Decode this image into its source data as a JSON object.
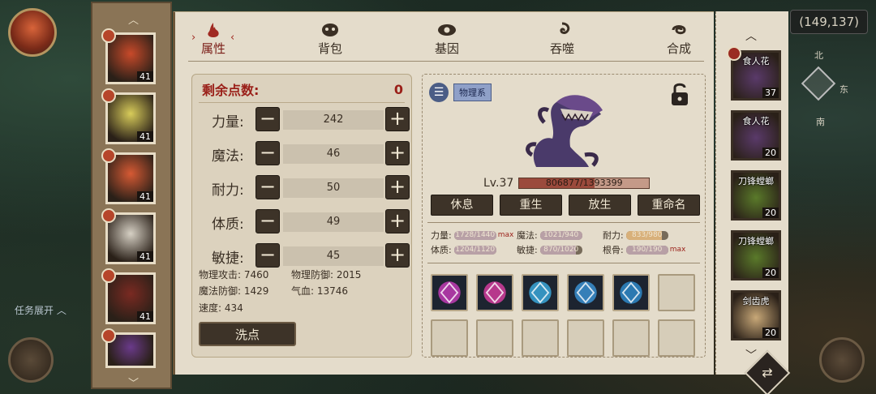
{
  "map": {
    "coords": "(149,137)",
    "compass": {
      "north": "北",
      "east": "东",
      "south": "南"
    },
    "quest_toggle": "任务展开"
  },
  "tabs": [
    {
      "label": "属性",
      "active": true,
      "icon": "flame-icon"
    },
    {
      "label": "背包",
      "active": false,
      "icon": "beast-head-icon"
    },
    {
      "label": "基因",
      "active": false,
      "icon": "eye-emblem-icon"
    },
    {
      "label": "吞噬",
      "active": false,
      "icon": "swirl-icon"
    },
    {
      "label": "合成",
      "active": false,
      "icon": "spiral-icon"
    }
  ],
  "stats": {
    "remaining_label": "剩余点数:",
    "remaining_value": "0",
    "attributes": [
      {
        "label": "力量:",
        "value": "242"
      },
      {
        "label": "魔法:",
        "value": "46"
      },
      {
        "label": "耐力:",
        "value": "50"
      },
      {
        "label": "体质:",
        "value": "49"
      },
      {
        "label": "敏捷:",
        "value": "45"
      }
    ],
    "minus": "−",
    "plus": "+",
    "derived": [
      {
        "text": "物理攻击: 7460"
      },
      {
        "text": "物理防御: 2015"
      },
      {
        "text": "魔法防御: 1429"
      },
      {
        "text": "气血: 13746"
      },
      {
        "text": "速度: 434"
      }
    ],
    "reset_label": "洗点"
  },
  "pet": {
    "type_tag": "物理系",
    "level": "Lv.37",
    "hp_text": "806877/1393399",
    "hp_fraction": 0.579,
    "actions": [
      "休息",
      "重生",
      "放生",
      "重命名"
    ],
    "aptitudes": [
      {
        "label": "力量:",
        "value": "1728/1440",
        "max": "max",
        "fraction": 1.0,
        "style": "normal"
      },
      {
        "label": "魔法:",
        "value": "1021/940",
        "max": "",
        "fraction": 1.0,
        "style": "normal"
      },
      {
        "label": "耐力:",
        "value": "833/980",
        "max": "",
        "fraction": 0.85,
        "style": "orange"
      },
      {
        "label": "体质:",
        "value": "1204/1120",
        "max": "",
        "fraction": 1.0,
        "style": "normal"
      },
      {
        "label": "敏捷:",
        "value": "870/1020",
        "max": "",
        "fraction": 0.85,
        "style": "normal"
      },
      {
        "label": "根骨:",
        "value": "190/190",
        "max": "max",
        "fraction": 1.0,
        "style": "normal"
      }
    ],
    "skills": [
      {
        "filled": true,
        "color": "#c13bb4",
        "icon": "burst-skill-icon"
      },
      {
        "filled": true,
        "color": "#d23c9c",
        "icon": "demon-skill-icon"
      },
      {
        "filled": true,
        "color": "#38a6d8",
        "icon": "whirl-skill-icon"
      },
      {
        "filled": true,
        "color": "#3a8fd0",
        "icon": "slash-skill-icon"
      },
      {
        "filled": true,
        "color": "#2e88c8",
        "icon": "claw-skill-icon"
      },
      {
        "filled": false
      },
      {
        "filled": false
      },
      {
        "filled": false
      },
      {
        "filled": false
      },
      {
        "filled": false
      },
      {
        "filled": false
      },
      {
        "filled": false
      }
    ]
  },
  "party": [
    {
      "level": "41",
      "color": "#c84a2a"
    },
    {
      "level": "41",
      "color": "#d8cc5a"
    },
    {
      "level": "41",
      "color": "#d65a34"
    },
    {
      "level": "41",
      "color": "#d6d0c4"
    },
    {
      "level": "41",
      "color": "#7a2a22"
    },
    {
      "level": "",
      "color": "#6a3a8a"
    }
  ],
  "bank": [
    {
      "name": "食人花",
      "level": "37",
      "color": "#5a3a6a"
    },
    {
      "name": "食人花",
      "level": "20",
      "color": "#5a3a6a"
    },
    {
      "name": "刀锋螳螂",
      "level": "20",
      "color": "#5a7a2a"
    },
    {
      "name": "刀锋螳螂",
      "level": "20",
      "color": "#5a7a2a"
    },
    {
      "name": "剑齿虎",
      "level": "20",
      "color": "#c8a878"
    }
  ]
}
